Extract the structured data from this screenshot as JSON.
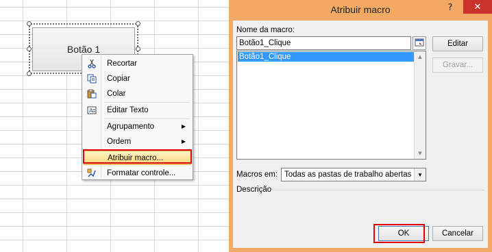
{
  "sheet": {
    "button_label": "Botão 1"
  },
  "context_menu": {
    "items": [
      {
        "label": "Recortar",
        "icon": "scissors-icon"
      },
      {
        "label": "Copiar",
        "icon": "copy-icon"
      },
      {
        "label": "Colar",
        "icon": "paste-icon"
      },
      {
        "label": "Editar Texto",
        "icon": "edit-text-icon"
      },
      {
        "label": "Agrupamento",
        "icon": "",
        "submenu": true
      },
      {
        "label": "Ordem",
        "icon": "",
        "submenu": true
      },
      {
        "label": "Atribuir macro...",
        "icon": "",
        "highlighted": true
      },
      {
        "label": "Formatar controle...",
        "icon": "format-control-icon"
      }
    ]
  },
  "dialog": {
    "title": "Atribuir macro",
    "help": "?",
    "close": "✕",
    "macro_name_label": "Nome da macro:",
    "macro_name_value": "Botão1_Clique",
    "macro_list": [
      "Botão1_Clique"
    ],
    "edit_button": "Editar",
    "record_button": "Gravar...",
    "macros_in_label": "Macros em:",
    "macros_in_value": "Todas as pastas de trabalho abertas",
    "description_label": "Descrição",
    "ok_button": "OK",
    "cancel_button": "Cancelar"
  },
  "colors": {
    "title_bar": "#f3a963",
    "close_button": "#c9332b",
    "selection": "#3399ff",
    "highlight_outline": "#e00000"
  }
}
